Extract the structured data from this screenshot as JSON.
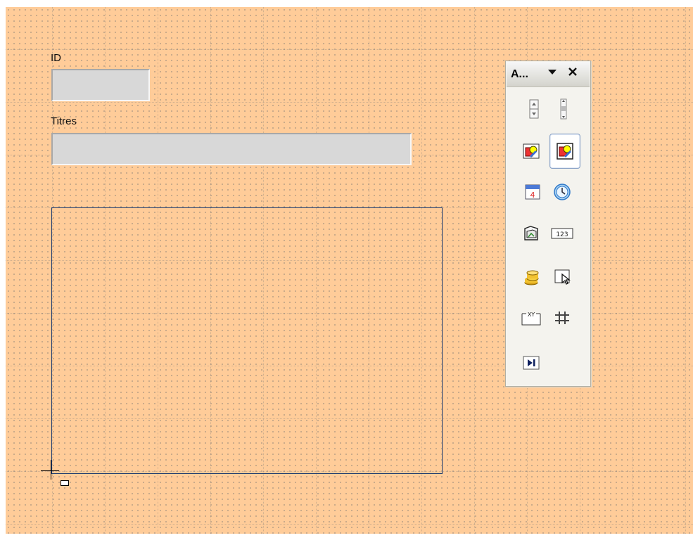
{
  "form": {
    "id_label": "ID",
    "titles_label": "Titres",
    "id_value": "",
    "titles_value": ""
  },
  "toolbar": {
    "title": "A...",
    "dropdown_icon": "triangle-down-icon",
    "close_icon": "close-icon",
    "tools": [
      {
        "name": "spin-button-icon",
        "selected": false
      },
      {
        "name": "scrollbar-icon",
        "selected": false
      },
      {
        "name": "image-button-icon",
        "selected": false
      },
      {
        "name": "image-control-icon",
        "selected": true
      },
      {
        "name": "date-field-icon",
        "selected": false
      },
      {
        "name": "time-field-icon",
        "selected": false
      },
      {
        "name": "file-selection-icon",
        "selected": false
      },
      {
        "name": "numeric-field-icon",
        "selected": false
      },
      {
        "name": "currency-field-icon",
        "selected": false
      },
      {
        "name": "pattern-field-icon",
        "selected": false
      },
      {
        "name": "table-control-icon",
        "selected": false
      },
      {
        "name": "grid-control-icon",
        "selected": false
      },
      {
        "name": "navigation-bar-icon",
        "selected": false
      }
    ],
    "numeric_icon_text": "123",
    "pattern_icon_text": "XY"
  }
}
